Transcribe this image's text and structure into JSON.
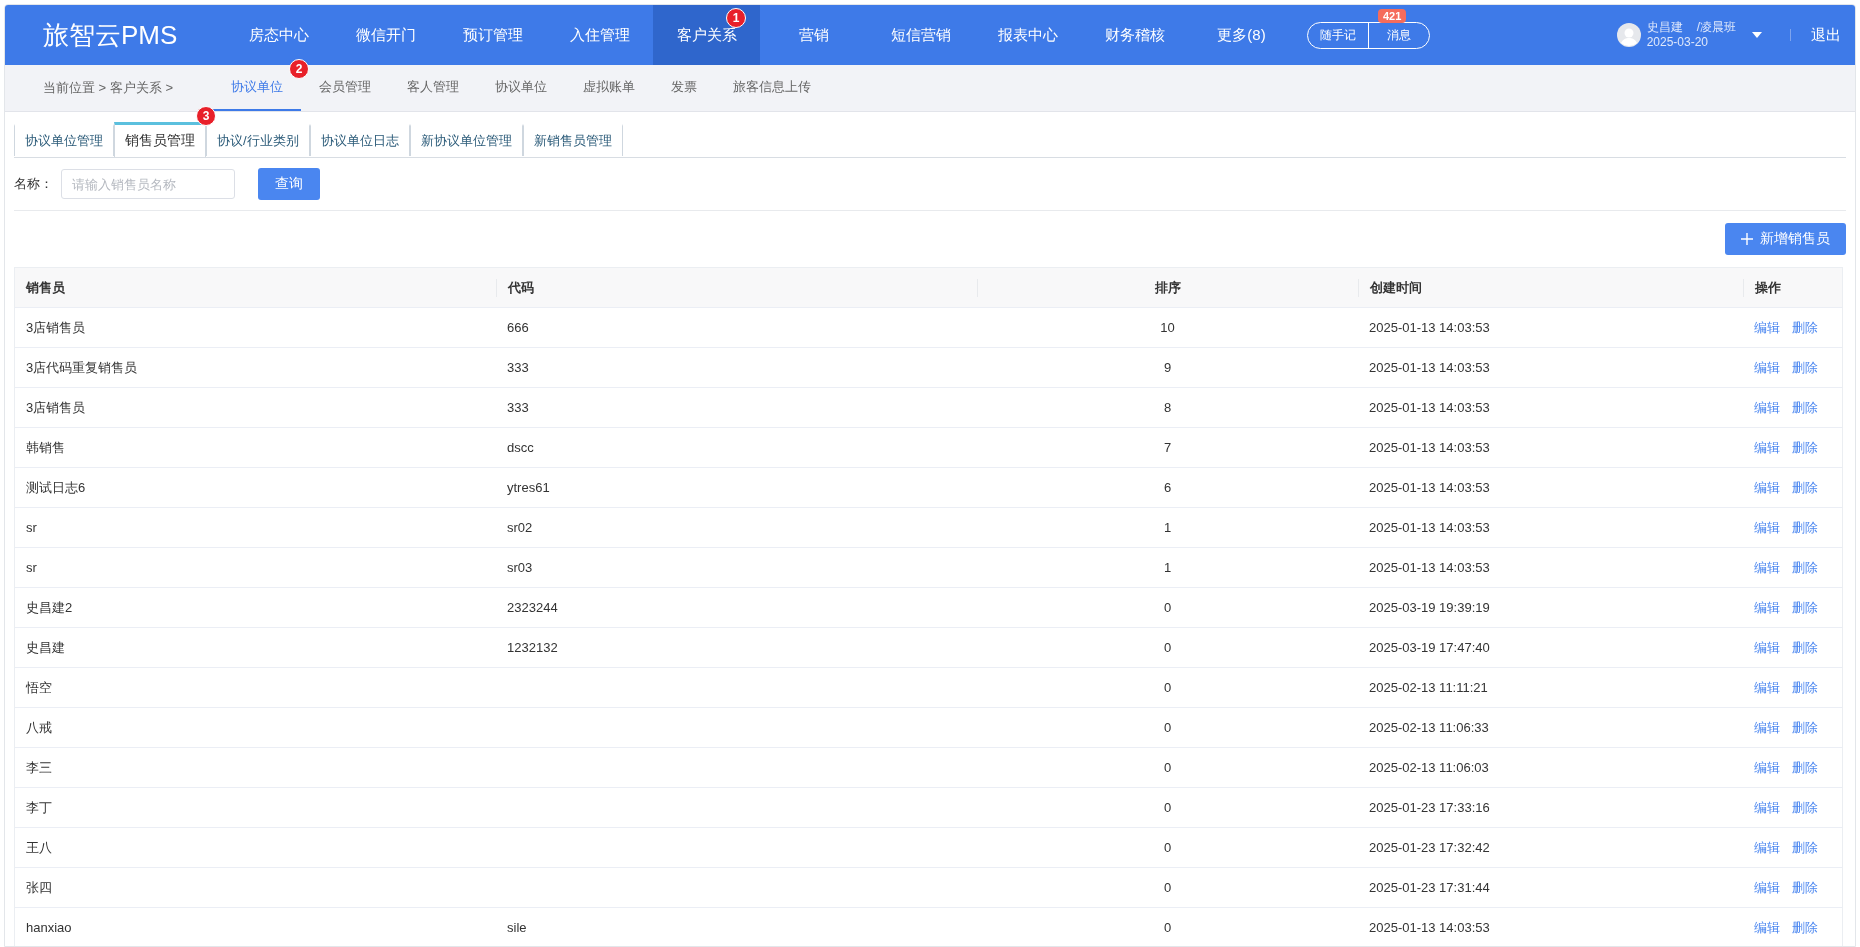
{
  "header": {
    "logo": "旅智云PMS",
    "nav": [
      {
        "label": "房态中心",
        "selected": false
      },
      {
        "label": "微信开门",
        "selected": false
      },
      {
        "label": "预订管理",
        "selected": false
      },
      {
        "label": "入住管理",
        "selected": false
      },
      {
        "label": "客户关系",
        "selected": true,
        "marker": "1"
      },
      {
        "label": "营销",
        "selected": false
      },
      {
        "label": "短信营销",
        "selected": false
      },
      {
        "label": "报表中心",
        "selected": false
      },
      {
        "label": "财务稽核",
        "selected": false
      },
      {
        "label": "更多(8)",
        "selected": false
      }
    ],
    "quick_buttons": [
      "随手记",
      "消息"
    ],
    "message_badge": "421",
    "user": {
      "name": "史昌建",
      "shift": "/凌晨班",
      "date": "2025-03-20"
    },
    "logout": "退出"
  },
  "breadcrumb": "当前位置 > 客户关系 >",
  "subnav": [
    {
      "label": "协议单位",
      "selected": true,
      "marker": "2"
    },
    {
      "label": "会员管理",
      "selected": false
    },
    {
      "label": "客人管理",
      "selected": false
    },
    {
      "label": "协议单位",
      "selected": false
    },
    {
      "label": "虚拟账单",
      "selected": false
    },
    {
      "label": "发票",
      "selected": false
    },
    {
      "label": "旅客信息上传",
      "selected": false
    }
  ],
  "tabs": [
    {
      "label": "协议单位管理",
      "selected": false
    },
    {
      "label": "销售员管理",
      "selected": true,
      "marker": "3"
    },
    {
      "label": "协议/行业类别",
      "selected": false
    },
    {
      "label": "协议单位日志",
      "selected": false
    },
    {
      "label": "新协议单位管理",
      "selected": false
    },
    {
      "label": "新销售员管理",
      "selected": false
    }
  ],
  "search": {
    "label": "名称：",
    "placeholder": "请输入销售员名称",
    "button": "查询"
  },
  "add_button": "新增销售员",
  "table": {
    "columns": [
      "销售员",
      "代码",
      "排序",
      "创建时间",
      "操作"
    ],
    "rows": [
      {
        "cells": [
          "3店销售员",
          "666",
          "10",
          "2025-01-13 14:03:53"
        ],
        "actions": [
          "编辑",
          "删除"
        ]
      },
      {
        "cells": [
          "3店代码重复销售员",
          "333",
          "9",
          "2025-01-13 14:03:53"
        ],
        "actions": [
          "编辑",
          "删除"
        ]
      },
      {
        "cells": [
          "3店销售员",
          "333",
          "8",
          "2025-01-13 14:03:53"
        ],
        "actions": [
          "编辑",
          "删除"
        ]
      },
      {
        "cells": [
          "韩销售",
          "dscc",
          "7",
          "2025-01-13 14:03:53"
        ],
        "actions": [
          "编辑",
          "删除"
        ]
      },
      {
        "cells": [
          "测试日志6",
          "ytres61",
          "6",
          "2025-01-13 14:03:53"
        ],
        "actions": [
          "编辑",
          "删除"
        ]
      },
      {
        "cells": [
          "sr",
          "sr02",
          "1",
          "2025-01-13 14:03:53"
        ],
        "actions": [
          "编辑",
          "删除"
        ]
      },
      {
        "cells": [
          "sr",
          "sr03",
          "1",
          "2025-01-13 14:03:53"
        ],
        "actions": [
          "编辑",
          "删除"
        ]
      },
      {
        "cells": [
          "史昌建2",
          "2323244",
          "0",
          "2025-03-19 19:39:19"
        ],
        "actions": [
          "编辑",
          "删除"
        ]
      },
      {
        "cells": [
          "史昌建",
          "1232132",
          "0",
          "2025-03-19 17:47:40"
        ],
        "actions": [
          "编辑",
          "删除"
        ]
      },
      {
        "cells": [
          "悟空",
          "",
          "0",
          "2025-02-13 11:11:21"
        ],
        "actions": [
          "编辑",
          "删除"
        ]
      },
      {
        "cells": [
          "八戒",
          "",
          "0",
          "2025-02-13 11:06:33"
        ],
        "actions": [
          "编辑",
          "删除"
        ]
      },
      {
        "cells": [
          "李三",
          "",
          "0",
          "2025-02-13 11:06:03"
        ],
        "actions": [
          "编辑",
          "删除"
        ]
      },
      {
        "cells": [
          "李丁",
          "",
          "0",
          "2025-01-23 17:33:16"
        ],
        "actions": [
          "编辑",
          "删除"
        ]
      },
      {
        "cells": [
          "王八",
          "",
          "0",
          "2025-01-23 17:32:42"
        ],
        "actions": [
          "编辑",
          "删除"
        ]
      },
      {
        "cells": [
          "张四",
          "",
          "0",
          "2025-01-23 17:31:44"
        ],
        "actions": [
          "编辑",
          "删除"
        ]
      },
      {
        "cells": [
          "hanxiao",
          "sile",
          "0",
          "2025-01-13 14:03:53"
        ],
        "actions": [
          "编辑",
          "删除"
        ]
      }
    ]
  }
}
